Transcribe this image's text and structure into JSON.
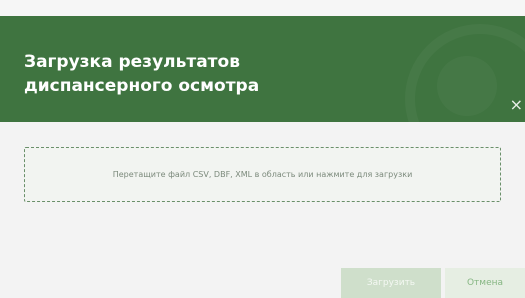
{
  "dialog": {
    "title_line1": "Загрузка результатов",
    "title_line2": "диспансерного осмотра",
    "close_icon": "×"
  },
  "dropzone": {
    "text": "Перетащите файл CSV, DBF, XML в область или нажмите для загрузки"
  },
  "buttons": {
    "upload_label": "Загрузить",
    "cancel_label": "Отмена"
  },
  "colors": {
    "header": "#3f7440",
    "body": "#f3f3f3",
    "dropzone_border": "#6a8f6a",
    "upload_button": "#cfdfcb",
    "cancel_button": "#e6eee3",
    "cancel_text": "#86b683"
  },
  "icons": {
    "close": "close-icon"
  }
}
